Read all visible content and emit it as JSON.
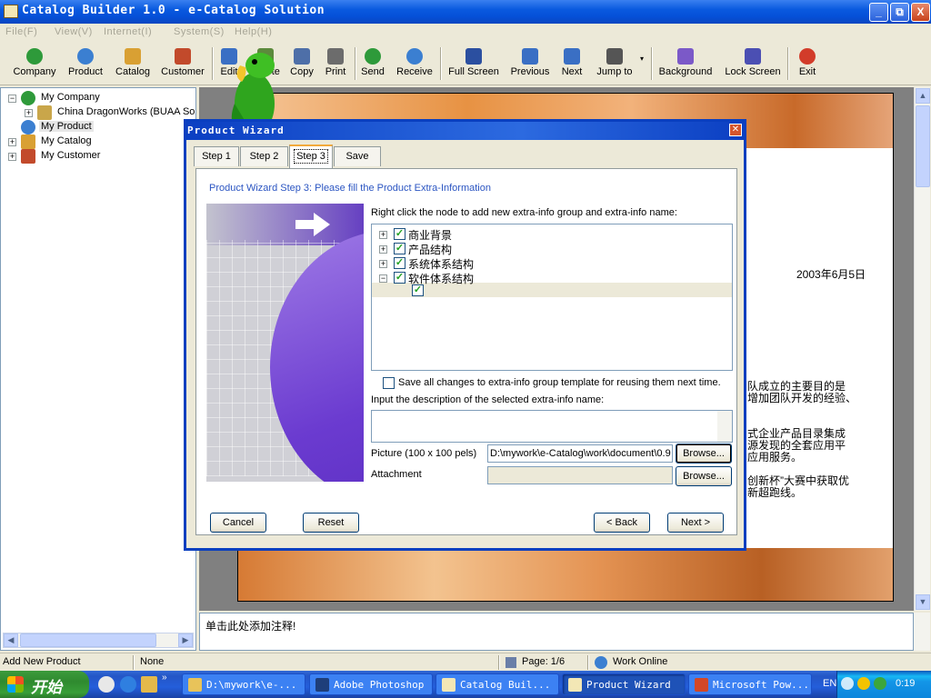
{
  "window": {
    "title": "Catalog Builder 1.0 - e-Catalog Solution",
    "controls": [
      "_",
      "⧉",
      "X"
    ]
  },
  "menu": [
    "File(F)",
    "View(V)",
    "Internet(I)",
    "System(S)",
    "Help(H)"
  ],
  "toolbar": [
    {
      "label": "Company",
      "icon": "globe-icon",
      "color": "#2e9a3a"
    },
    {
      "label": "Product",
      "icon": "globe-gear-icon",
      "color": "#3b7fd1"
    },
    {
      "label": "Catalog",
      "icon": "catalog-icon",
      "color": "#d9a033"
    },
    {
      "label": "Customer",
      "icon": "customer-icon",
      "color": "#c24a2b"
    },
    {
      "label": "Edit",
      "icon": "edit-icon",
      "color": "#3a6fc4"
    },
    {
      "label": "Delete",
      "icon": "delete-icon",
      "color": "#5c8a3c"
    },
    {
      "label": "Copy",
      "icon": "copy-icon",
      "color": "#4e6fa8"
    },
    {
      "label": "Print",
      "icon": "print-icon",
      "color": "#6c6c6c"
    },
    {
      "label": "Send",
      "icon": "send-icon",
      "color": "#2e9a3a"
    },
    {
      "label": "Receive",
      "icon": "receive-icon",
      "color": "#3b7fd1"
    },
    {
      "label": "Full Screen",
      "icon": "fullscreen-icon",
      "color": "#2b4fa0"
    },
    {
      "label": "Previous",
      "icon": "previous-icon",
      "color": "#3a6fc4"
    },
    {
      "label": "Next",
      "icon": "next-icon",
      "color": "#3a6fc4"
    },
    {
      "label": "Jump to",
      "icon": "jump-icon",
      "color": "#555"
    },
    {
      "label": "Background",
      "icon": "background-icon",
      "color": "#7b59c8"
    },
    {
      "label": "Lock Screen",
      "icon": "lock-icon",
      "color": "#4b4fb3"
    },
    {
      "label": "Exit",
      "icon": "exit-icon",
      "color": "#d23c2a"
    }
  ],
  "tree": {
    "my_company": "My Company",
    "company_child": "China DragonWorks (BUAA So",
    "my_product": "My Product",
    "my_catalog": "My Catalog",
    "my_customer": "My Customer"
  },
  "document": {
    "date": "2003年6月5日",
    "lines": [
      "队成立的主要目的是",
      "增加团队开发的经验、",
      "式企业产品目录集成",
      "源发现的全套应用平",
      "应用服务。",
      "创新杯”大赛中获取优",
      "新超跑线。"
    ]
  },
  "note": "单击此处添加注释!",
  "status": {
    "action": "Add New Product",
    "selection": "None",
    "page": "Page: 1/6",
    "mode": "Work Online"
  },
  "wizard": {
    "title": "Product Wizard",
    "tabs": [
      "Step 1",
      "Step 2",
      "Step 3",
      "Save"
    ],
    "heading": "Product Wizard Step 3: Please fill the Product Extra-Information",
    "tree_instruction": "Right click the node to add new extra-info group and extra-info name:",
    "tree_items": [
      "商业背景",
      "产品结构",
      "系统体系结构",
      "软件体系结构"
    ],
    "save_template_label": "Save all changes to extra-info group template for reusing them next time.",
    "description_label": "Input the description of the selected extra-info name:",
    "picture_label": "Picture (100 x 100 pels)",
    "picture_value": "D:\\mywork\\e-Catalog\\work\\document\\0.9",
    "attachment_label": "Attachment",
    "browse_label": "Browse...",
    "cancel_label": "Cancel",
    "reset_label": "Reset",
    "back_label": "< Back",
    "next_label": "Next >"
  },
  "taskbar": {
    "start": "开始",
    "tasks": [
      "D:\\mywork\\e-...",
      "Adobe Photoshop",
      "Catalog Buil...",
      "Product Wizard",
      "Microsoft Pow..."
    ],
    "lang": "EN",
    "clock": "0:19"
  }
}
